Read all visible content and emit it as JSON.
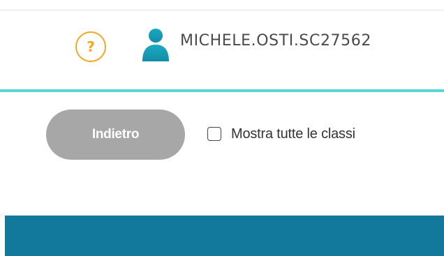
{
  "header": {
    "help_label": "?",
    "help_icon": "question-circle-icon",
    "user_icon": "user-icon",
    "username": "MICHELE.OSTI.SC27562"
  },
  "toolbar": {
    "back_label": "Indietro",
    "show_all_label": "Mostra tutte le classi",
    "show_all_checked": false
  },
  "colors": {
    "help_accent": "#f5a623",
    "user_icon": "#17a2b8",
    "accent_line": "#55d6d8",
    "back_button": "#a7a7a7",
    "bottom_bar": "#12799d"
  }
}
